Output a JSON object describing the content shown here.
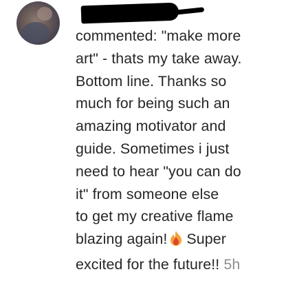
{
  "comment": {
    "lines": [
      "commented: \"make more",
      "art\" - thats my take away.",
      "Bottom line. Thanks so",
      "much for being such an",
      "amazing motivator and",
      "guide. Sometimes i just",
      "need to hear \"you can do",
      "it\" from someone else",
      "to get my creative flame",
      "blazing again!",
      "Super",
      "excited for the future!!"
    ],
    "emoji": "fire-icon",
    "timestamp": "5h"
  },
  "colors": {
    "text": "#262626",
    "timestamp": "#8e8e8e",
    "flame_outer": "#f4a23a",
    "flame_inner": "#e0452a"
  }
}
